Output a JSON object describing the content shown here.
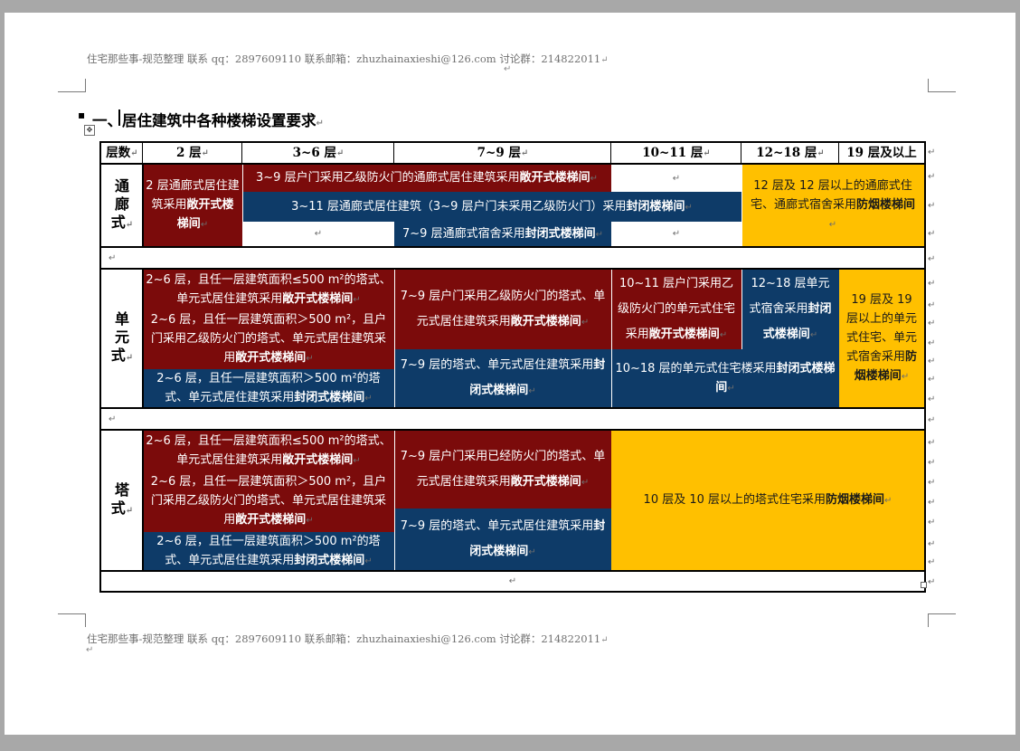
{
  "header_text": "住宅那些事-规范整理   联系 qq：2897609110 联系邮箱：zhuzhainaxieshi@126.com 讨论群：214822011",
  "footer_text": "住宅那些事-规范整理   联系 qq：2897609110 联系邮箱：zhuzhainaxieshi@126.com 讨论群：214822011",
  "paragraph_mark": "↵",
  "heading": "一、居住建筑中各种楼梯设置要求",
  "table": {
    "headers": [
      "层数",
      "2 层",
      "3~6 层",
      "7~9 层",
      "10~11 层",
      "12~18 层",
      "19 层及以上"
    ],
    "categories": {
      "corridor": "通廊式",
      "unit": "单元式",
      "tower": "塔式"
    },
    "corridor": {
      "c2": {
        "pre": "2 层通廊式居住建筑采用",
        "bold": "敞开式楼梯间"
      },
      "r1": {
        "pre": "3~9 层户门采用乙级防火门的通廊式居住建筑采用",
        "bold": "敞开式楼梯间"
      },
      "r2": {
        "pre": "3~11 层通廊式居住建筑（3~9 层户门未采用乙级防火门）采用",
        "bold": "封闭楼梯间"
      },
      "r3": {
        "pre": "7~9 层通廊式宿舍采用",
        "bold": "封闭式楼梯间"
      },
      "right": {
        "pre": "12 层及 12 层以上的通廊式住宅、通廊式宿舍采用",
        "bold": "防烟楼梯间"
      }
    },
    "unit": {
      "a1": {
        "pre": "2~6 层，且任一层建筑面积≤500 m²的塔式、单元式居住建筑采用",
        "bold": "敞开式楼梯间"
      },
      "a2": {
        "pre": "2~6 层，且任一层建筑面积＞500 m²，且户门采用乙级防火门的塔式、单元式居住建筑采用",
        "bold": "敞开式楼梯间"
      },
      "a3": {
        "pre": "2~6 层，且任一层建筑面积＞500 m²的塔式、单元式居住建筑采用",
        "bold": "封闭式楼梯间"
      },
      "b1": {
        "pre": "7~9 层户门采用乙级防火门的塔式、单元式居住建筑采用",
        "bold": "敞开式楼梯间"
      },
      "b2": {
        "pre": "7~9 层的塔式、单元式居住建筑采用",
        "bold": "封闭式楼梯间"
      },
      "c1": {
        "pre": "10~11 层户门采用乙级防火门的单元式住宅采用",
        "bold": "敞开式楼梯间"
      },
      "d1": {
        "pre": "12~18 层单元式宿舍采用",
        "bold": "封闭式楼梯间"
      },
      "cd2": {
        "pre": "10~18 层的单元式住宅楼采用",
        "bold": "封闭式楼梯间"
      },
      "e": {
        "pre": "19 层及 19 层以上的单元式住宅、单元式宿舍采用",
        "bold": "防烟楼梯间"
      }
    },
    "tower": {
      "a1": {
        "pre": "2~6 层，且任一层建筑面积≤500 m²的塔式、单元式居住建筑采用",
        "bold": "敞开式楼梯间"
      },
      "a2": {
        "pre": "2~6 层，且任一层建筑面积＞500 m²，且户门采用乙级防火门的塔式、单元式居住建筑采用",
        "bold": "敞开式楼梯间"
      },
      "a3": {
        "pre": "2~6 层，且任一层建筑面积＞500 m²的塔式、单元式居住建筑采用",
        "bold": "封闭式楼梯间"
      },
      "b1": {
        "pre": "7~9 层户门采用已经防火门的塔式、单元式居住建筑采用",
        "bold": "敞开式楼梯间"
      },
      "b2": {
        "pre": "7~9 层的塔式、单元式居住建筑采用",
        "bold": "封闭式楼梯间"
      },
      "right": {
        "pre": "10 层及 10 层以上的塔式住宅采用",
        "bold": "防烟楼梯间"
      }
    }
  },
  "colors": {
    "red": "#7b0b0b",
    "blue": "#0e3b68",
    "yellow": "#ffc000"
  }
}
